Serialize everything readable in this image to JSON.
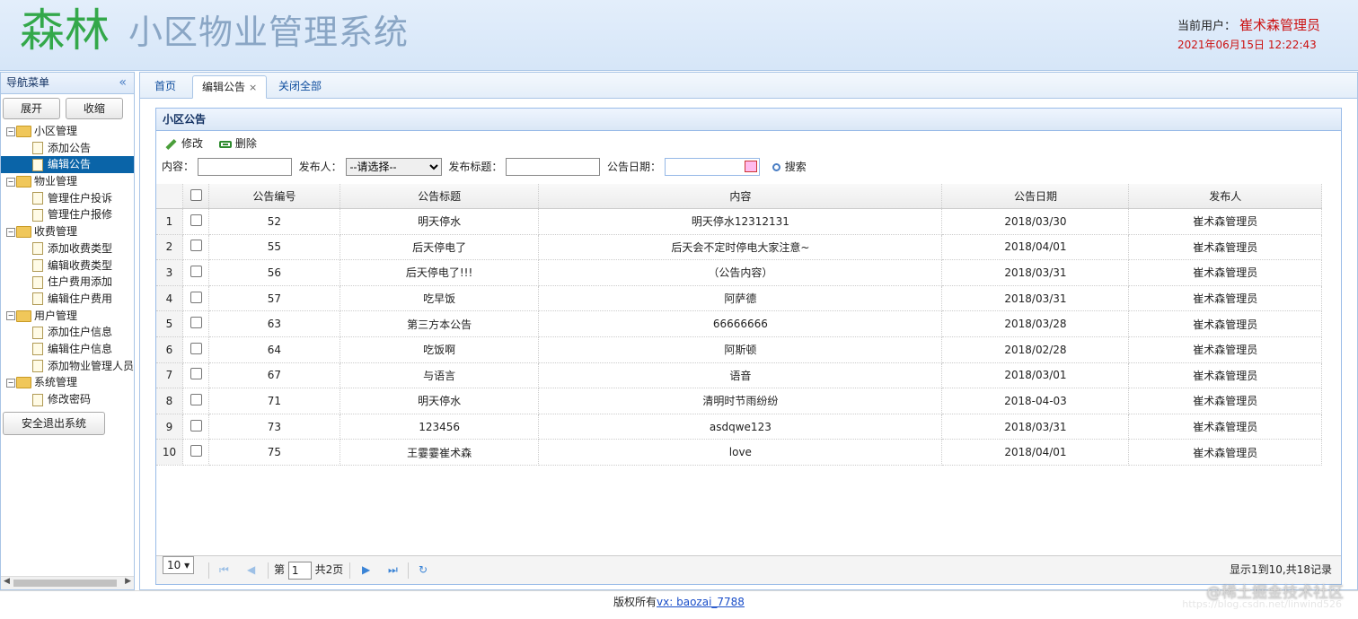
{
  "header": {
    "logo": "森林",
    "title": "小区物业管理系统",
    "user_label": "当前用户：",
    "user_name": "崔术森管理员",
    "datetime": "2021年06月15日 12:22:43"
  },
  "sidebar": {
    "title": "导航菜单",
    "collapse_icon": "«",
    "expand_btn": "展开",
    "collapse_btn": "收缩",
    "groups": [
      {
        "label": "小区管理",
        "items": [
          "添加公告",
          "编辑公告"
        ]
      },
      {
        "label": "物业管理",
        "items": [
          "管理住户投诉",
          "管理住户报修"
        ]
      },
      {
        "label": "收费管理",
        "items": [
          "添加收费类型",
          "编辑收费类型",
          "住户费用添加",
          "编辑住户费用"
        ]
      },
      {
        "label": "用户管理",
        "items": [
          "添加住户信息",
          "编辑住户信息",
          "添加物业管理人员"
        ]
      },
      {
        "label": "系统管理",
        "items": [
          "修改密码"
        ]
      }
    ],
    "selected_item": "编辑公告",
    "logout": "安全退出系统"
  },
  "tabs": {
    "home": "首页",
    "edit_notice": "编辑公告",
    "close_all": "关闭全部"
  },
  "panel": {
    "title": "小区公告",
    "toolbar": {
      "edit": "修改",
      "delete": "删除"
    },
    "search": {
      "content_label": "内容：",
      "publisher_label": "发布人：",
      "publisher_selected": "--请选择--",
      "title_label": "发布标题：",
      "date_label": "公告日期：",
      "search_btn": "搜索"
    },
    "columns": [
      "公告编号",
      "公告标题",
      "内容",
      "公告日期",
      "发布人"
    ],
    "rows": [
      {
        "n": "1",
        "id": "52",
        "title": "明天停水",
        "content": "明天停水12312131",
        "date": "2018/03/30",
        "publisher": "崔术森管理员"
      },
      {
        "n": "2",
        "id": "55",
        "title": "后天停电了",
        "content": "后天会不定时停电大家注意~",
        "date": "2018/04/01",
        "publisher": "崔术森管理员"
      },
      {
        "n": "3",
        "id": "56",
        "title": "后天停电了!!!",
        "content": "（公告内容）",
        "date": "2018/03/31",
        "publisher": "崔术森管理员"
      },
      {
        "n": "4",
        "id": "57",
        "title": "吃早饭",
        "content": "阿萨德",
        "date": "2018/03/31",
        "publisher": "崔术森管理员"
      },
      {
        "n": "5",
        "id": "63",
        "title": "第三方本公告",
        "content": "66666666",
        "date": "2018/03/28",
        "publisher": "崔术森管理员"
      },
      {
        "n": "6",
        "id": "64",
        "title": "吃饭啊",
        "content": "阿斯顿",
        "date": "2018/02/28",
        "publisher": "崔术森管理员"
      },
      {
        "n": "7",
        "id": "67",
        "title": "与语言",
        "content": "语音",
        "date": "2018/03/01",
        "publisher": "崔术森管理员"
      },
      {
        "n": "8",
        "id": "71",
        "title": "明天停水",
        "content": "清明时节雨纷纷",
        "date": "2018-04-03",
        "publisher": "崔术森管理员"
      },
      {
        "n": "9",
        "id": "73",
        "title": "123456",
        "content": "asdqwe123",
        "date": "2018/03/31",
        "publisher": "崔术森管理员"
      },
      {
        "n": "10",
        "id": "75",
        "title": "王霎霎崔术森",
        "content": "love",
        "date": "2018/04/01",
        "publisher": "崔术森管理员"
      }
    ]
  },
  "pager": {
    "page_size": "10",
    "page_prefix": "第",
    "page_value": "1",
    "page_suffix": "共2页",
    "summary": "显示1到10,共18记录"
  },
  "footer": {
    "text": "版权所有",
    "link": "vx: baozai_7788"
  },
  "watermark": {
    "text": "@稀土掘金技术社区",
    "url": "https://blog.csdn.net/linwind526"
  }
}
